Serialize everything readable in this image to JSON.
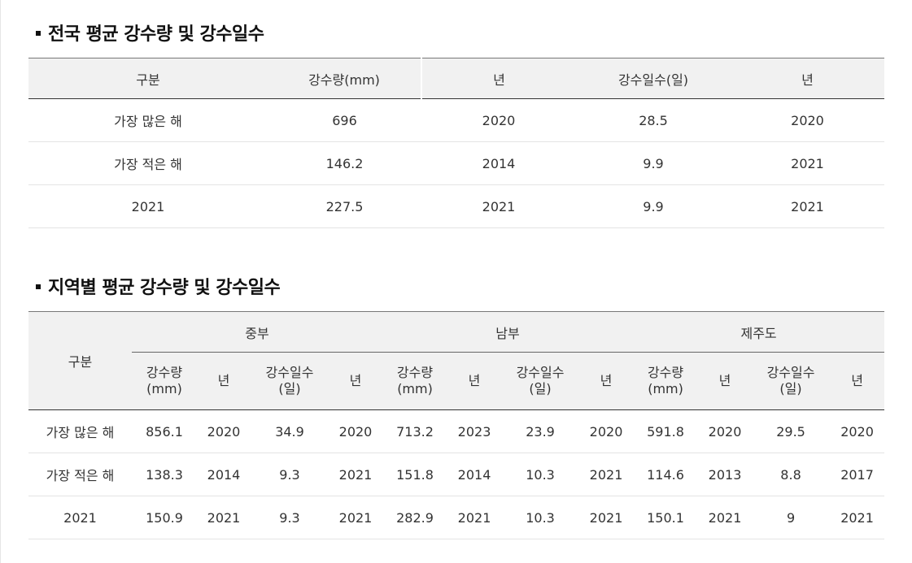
{
  "national": {
    "title": "전국 평균 강수량 및 강수일수",
    "headers": [
      "구분",
      "강수량(mm)",
      "년",
      "강수일수(일)",
      "년"
    ],
    "rows": [
      [
        "가장 많은 해",
        "696",
        "2020",
        "28.5",
        "2020"
      ],
      [
        "가장 적은 해",
        "146.2",
        "2014",
        "9.9",
        "2021"
      ],
      [
        "2021",
        "227.5",
        "2021",
        "9.9",
        "2021"
      ]
    ]
  },
  "regional": {
    "title": "지역별 평균 강수량 및 강수일수",
    "gubun": "구분",
    "regions": [
      "중부",
      "남부",
      "제주도"
    ],
    "sub_headers": [
      {
        "line1": "강수량",
        "line2": "(mm)"
      },
      {
        "line1": "년",
        "line2": ""
      },
      {
        "line1": "강수일수",
        "line2": "(일)"
      },
      {
        "line1": "년",
        "line2": ""
      }
    ],
    "rows": [
      [
        "가장 많은 해",
        "856.1",
        "2020",
        "34.9",
        "2020",
        "713.2",
        "2023",
        "23.9",
        "2020",
        "591.8",
        "2020",
        "29.5",
        "2020"
      ],
      [
        "가장 적은 해",
        "138.3",
        "2014",
        "9.3",
        "2021",
        "151.8",
        "2014",
        "10.3",
        "2021",
        "114.6",
        "2013",
        "8.8",
        "2017"
      ],
      [
        "2021",
        "150.9",
        "2021",
        "9.3",
        "2021",
        "282.9",
        "2021",
        "10.3",
        "2021",
        "150.1",
        "2021",
        "9",
        "2021"
      ]
    ]
  }
}
